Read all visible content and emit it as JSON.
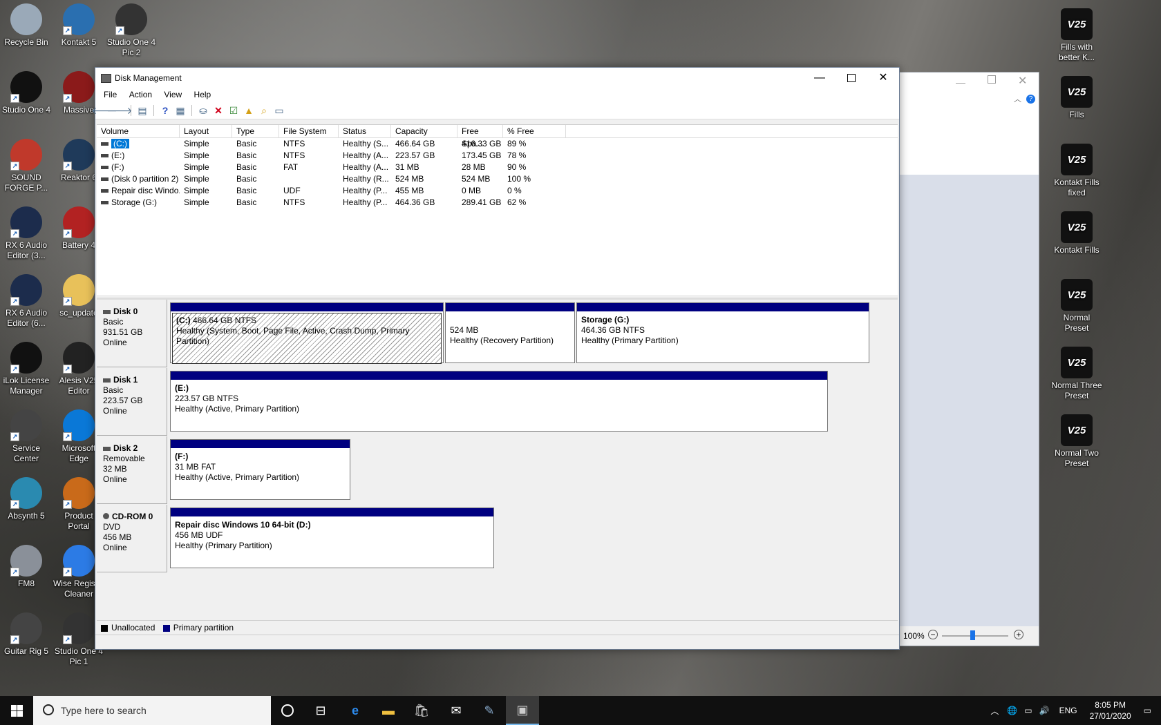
{
  "desktop": {
    "left_icons": [
      {
        "label": "Recycle Bin",
        "icon": "recycle-bin-icon",
        "color": "#9aa9b8"
      },
      {
        "label": "Kontakt 5",
        "icon": "kontakt-icon",
        "color": "#2a6fb0"
      },
      {
        "label": "Studio One 4 Pic 2",
        "icon": "studio-one-pic-icon",
        "color": "#333333"
      },
      {
        "label": "Studio One 4",
        "icon": "studio-one-icon",
        "color": "#111111"
      },
      {
        "label": "Massive",
        "icon": "massive-icon",
        "color": "#8b1a1a"
      },
      {
        "label": "SOUND FORGE P...",
        "icon": "sound-forge-icon",
        "color": "#c0392b"
      },
      {
        "label": "Reaktor 6",
        "icon": "reaktor-icon",
        "color": "#1f3a5a"
      },
      {
        "label": "RX 6 Audio Editor (3...",
        "icon": "rx-audio-icon",
        "color": "#1c2c4c"
      },
      {
        "label": "Battery 4",
        "icon": "battery-icon",
        "color": "#b22222"
      },
      {
        "label": "RX 6 Audio Editor (6...",
        "icon": "rx-audio-icon",
        "color": "#1c2c4c"
      },
      {
        "label": "sc_update",
        "icon": "folder-icon",
        "color": "#e8c15a"
      },
      {
        "label": "iLok License Manager",
        "icon": "ilok-icon",
        "color": "#111111"
      },
      {
        "label": "Alesis V25 Editor",
        "icon": "v25-icon",
        "color": "#222222"
      },
      {
        "label": "Service Center",
        "icon": "service-center-icon",
        "color": "#444444"
      },
      {
        "label": "Microsoft Edge",
        "icon": "edge-icon",
        "color": "#0a78d7"
      },
      {
        "label": "Absynth 5",
        "icon": "absynth-icon",
        "color": "#2a8ab0"
      },
      {
        "label": "Product Portal",
        "icon": "product-portal-icon",
        "color": "#c96a1a"
      },
      {
        "label": "FM8",
        "icon": "fm8-icon",
        "color": "#8a9099"
      },
      {
        "label": "Wise Registry Cleaner",
        "icon": "wise-cleaner-icon",
        "color": "#2c7be5"
      },
      {
        "label": "Guitar Rig 5",
        "icon": "guitar-rig-icon",
        "color": "#444444"
      },
      {
        "label": "Studio One 4 Pic 1",
        "icon": "studio-one-pic-icon",
        "color": "#333333"
      }
    ],
    "right_icons": [
      {
        "label": "Fills with better K...",
        "icon": "v25-file-icon"
      },
      {
        "label": "Fills",
        "icon": "v25-file-icon"
      },
      {
        "label": "Kontakt Fills fixed",
        "icon": "v25-file-icon"
      },
      {
        "label": "Kontakt Fills",
        "icon": "v25-file-icon"
      },
      {
        "label": "Normal Preset",
        "icon": "v25-file-icon"
      },
      {
        "label": "Normal Three Preset",
        "icon": "v25-file-icon"
      },
      {
        "label": "Normal Two Preset",
        "icon": "v25-file-icon"
      }
    ],
    "v25_text": "V25"
  },
  "background_window": {
    "zoom": "100%",
    "minus": "−",
    "plus": "+"
  },
  "window": {
    "title": "Disk Management",
    "menu": [
      "File",
      "Action",
      "View",
      "Help"
    ],
    "volume_columns": [
      "Volume",
      "Layout",
      "Type",
      "File System",
      "Status",
      "Capacity",
      "Free Spa...",
      "% Free"
    ],
    "volumes": [
      [
        "(C:)",
        "Simple",
        "Basic",
        "NTFS",
        "Healthy (S...",
        "466.64 GB",
        "416.33 GB",
        "89 %"
      ],
      [
        "(E:)",
        "Simple",
        "Basic",
        "NTFS",
        "Healthy (A...",
        "223.57 GB",
        "173.45 GB",
        "78 %"
      ],
      [
        "(F:)",
        "Simple",
        "Basic",
        "FAT",
        "Healthy (A...",
        "31 MB",
        "28 MB",
        "90 %"
      ],
      [
        "(Disk 0 partition 2)",
        "Simple",
        "Basic",
        "",
        "Healthy (R...",
        "524 MB",
        "524 MB",
        "100 %"
      ],
      [
        "Repair disc Windo...",
        "Simple",
        "Basic",
        "UDF",
        "Healthy (P...",
        "455 MB",
        "0 MB",
        "0 %"
      ],
      [
        "Storage (G:)",
        "Simple",
        "Basic",
        "NTFS",
        "Healthy (P...",
        "464.36 GB",
        "289.41 GB",
        "62 %"
      ]
    ],
    "disks": [
      {
        "name": "Disk 0",
        "type": "Basic",
        "size": "931.51 GB",
        "status": "Online",
        "partitions": [
          {
            "label": "(C:)",
            "size": "466.64 GB NTFS",
            "status": "Healthy (System, Boot, Page File, Active, Crash Dump, Primary Partition)"
          },
          {
            "label": "",
            "size": "524 MB",
            "status": "Healthy (Recovery Partition)"
          },
          {
            "label": "Storage  (G:)",
            "size": "464.36 GB NTFS",
            "status": "Healthy (Primary Partition)"
          }
        ]
      },
      {
        "name": "Disk 1",
        "type": "Basic",
        "size": "223.57 GB",
        "status": "Online",
        "partitions": [
          {
            "label": "(E:)",
            "size": "223.57 GB NTFS",
            "status": "Healthy (Active, Primary Partition)"
          }
        ]
      },
      {
        "name": "Disk 2",
        "type": "Removable",
        "size": "32 MB",
        "status": "Online",
        "partitions": [
          {
            "label": "(F:)",
            "size": "31 MB FAT",
            "status": "Healthy (Active, Primary Partition)"
          }
        ]
      },
      {
        "name": "CD-ROM 0",
        "type": "DVD",
        "size": "456 MB",
        "status": "Online",
        "partitions": [
          {
            "label": "Repair disc Windows 10 64-bit  (D:)",
            "size": "456 MB UDF",
            "status": "Healthy (Primary Partition)"
          }
        ]
      }
    ],
    "legend": {
      "unallocated": "Unallocated",
      "primary": "Primary partition",
      "unallocated_color": "#000000",
      "primary_color": "#000080"
    }
  },
  "taskbar": {
    "search_placeholder": "Type here to search",
    "tray_lang": "ENG",
    "time": "8:05 PM",
    "date": "27/01/2020"
  }
}
